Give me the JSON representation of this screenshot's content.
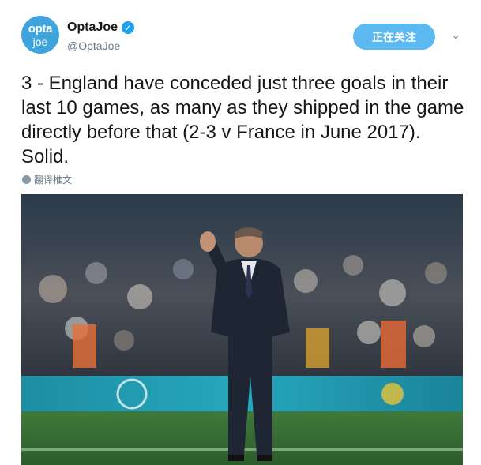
{
  "account": {
    "avatar_line1": "opta",
    "avatar_line2": "joe",
    "display_name": "OptaJoe",
    "handle": "@OptaJoe",
    "verified": true
  },
  "header": {
    "follow_button_label": "正在关注",
    "menu_icon": "chevron-down-icon"
  },
  "tweet": {
    "text": "3 - England have conceded just three goals in their last 10 games, as many as they shipped in the game directly before that (2-3 v France in June 2017). Solid.",
    "translate_label": "翻译推文"
  },
  "colors": {
    "accent": "#1da1f2",
    "follow_button": "#5bb8f0",
    "avatar": "#3fa3dc",
    "secondary_text": "#657786"
  }
}
